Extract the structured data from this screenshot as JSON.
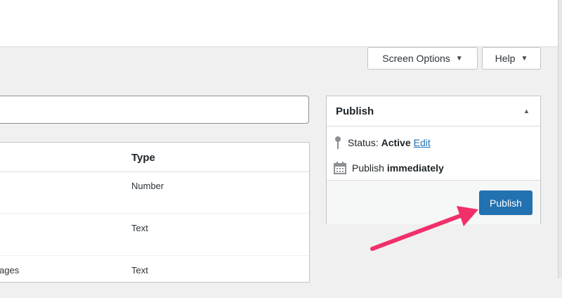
{
  "header": {
    "screen_options_label": "Screen Options",
    "help_label": "Help"
  },
  "title_input": {
    "value": ""
  },
  "fields_table": {
    "type_header": "Type",
    "rows": [
      {
        "name": "",
        "type": "Number"
      },
      {
        "name": "",
        "type": "Text"
      },
      {
        "name": "ages",
        "type": "Text"
      }
    ]
  },
  "publish_box": {
    "title": "Publish",
    "status_label": "Status:",
    "status_value": "Active",
    "edit_label": "Edit",
    "publish_label": "Publish",
    "publish_when": "immediately",
    "publish_button": "Publish"
  },
  "colors": {
    "accent": "#2271b1",
    "annotation_arrow": "#f0306a"
  }
}
